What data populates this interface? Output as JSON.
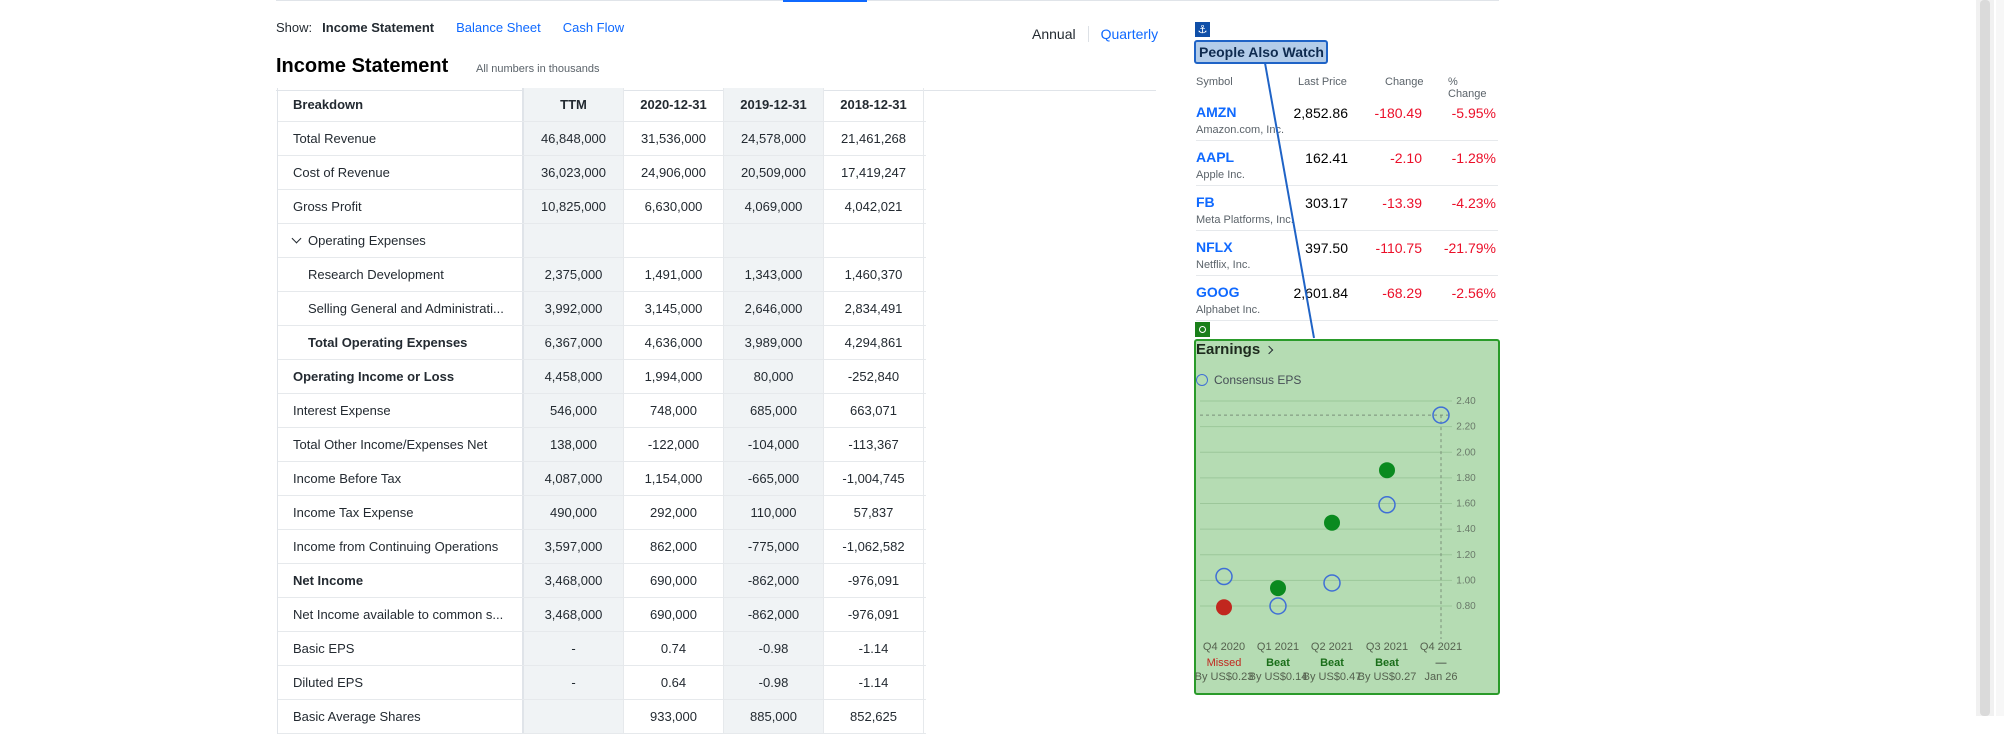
{
  "show": {
    "label": "Show:",
    "options": [
      "Income Statement",
      "Balance Sheet",
      "Cash Flow"
    ]
  },
  "period": {
    "annual": "Annual",
    "quarterly": "Quarterly"
  },
  "statement": {
    "title": "Income Statement",
    "note": "All numbers in thousands",
    "headers": [
      "Breakdown",
      "TTM",
      "2020-12-31",
      "2019-12-31",
      "2018-12-31"
    ],
    "rows": [
      {
        "label": "Total Revenue",
        "values": [
          "46,848,000",
          "31,536,000",
          "24,578,000",
          "21,461,268"
        ]
      },
      {
        "label": "Cost of Revenue",
        "values": [
          "36,023,000",
          "24,906,000",
          "20,509,000",
          "17,419,247"
        ]
      },
      {
        "label": "Gross Profit",
        "values": [
          "10,825,000",
          "6,630,000",
          "4,069,000",
          "4,042,021"
        ]
      },
      {
        "label": "Operating Expenses",
        "values": [
          "",
          "",
          "",
          ""
        ]
      },
      {
        "label": "Research Development",
        "values": [
          "2,375,000",
          "1,491,000",
          "1,343,000",
          "1,460,370"
        ]
      },
      {
        "label": "Selling General and Administrati...",
        "values": [
          "3,992,000",
          "3,145,000",
          "2,646,000",
          "2,834,491"
        ]
      },
      {
        "label": "Total Operating Expenses",
        "values": [
          "6,367,000",
          "4,636,000",
          "3,989,000",
          "4,294,861"
        ]
      },
      {
        "label": "Operating Income or Loss",
        "values": [
          "4,458,000",
          "1,994,000",
          "80,000",
          "-252,840"
        ]
      },
      {
        "label": "Interest Expense",
        "values": [
          "546,000",
          "748,000",
          "685,000",
          "663,071"
        ]
      },
      {
        "label": "Total Other Income/Expenses Net",
        "values": [
          "138,000",
          "-122,000",
          "-104,000",
          "-113,367"
        ]
      },
      {
        "label": "Income Before Tax",
        "values": [
          "4,087,000",
          "1,154,000",
          "-665,000",
          "-1,004,745"
        ]
      },
      {
        "label": "Income Tax Expense",
        "values": [
          "490,000",
          "292,000",
          "110,000",
          "57,837"
        ]
      },
      {
        "label": "Income from Continuing Operations",
        "values": [
          "3,597,000",
          "862,000",
          "-775,000",
          "-1,062,582"
        ]
      },
      {
        "label": "Net Income",
        "values": [
          "3,468,000",
          "690,000",
          "-862,000",
          "-976,091"
        ]
      },
      {
        "label": "Net Income available to common s...",
        "values": [
          "3,468,000",
          "690,000",
          "-862,000",
          "-976,091"
        ]
      },
      {
        "label": "Basic EPS",
        "values": [
          "-",
          "0.74",
          "-0.98",
          "-1.14"
        ]
      },
      {
        "label": "Diluted EPS",
        "values": [
          "-",
          "0.64",
          "-0.98",
          "-1.14"
        ]
      },
      {
        "label": "Basic Average Shares",
        "values": [
          "",
          "933,000",
          "885,000",
          "852,625"
        ]
      }
    ]
  },
  "people_also_watch": {
    "title": "People Also Watch",
    "anchor_icon": "anchor-icon",
    "headers": [
      "Symbol",
      "Last Price",
      "Change",
      "% Change"
    ],
    "items": [
      {
        "symbol": "AMZN",
        "name": "Amazon.com, Inc.",
        "price": "2,852.86",
        "change": "-180.49",
        "pct": "-5.95%"
      },
      {
        "symbol": "AAPL",
        "name": "Apple Inc.",
        "price": "162.41",
        "change": "-2.10",
        "pct": "-1.28%"
      },
      {
        "symbol": "FB",
        "name": "Meta Platforms, Inc.",
        "price": "303.17",
        "change": "-13.39",
        "pct": "-4.23%"
      },
      {
        "symbol": "NFLX",
        "name": "Netflix, Inc.",
        "price": "397.50",
        "change": "-110.75",
        "pct": "-21.79%"
      },
      {
        "symbol": "GOOG",
        "name": "Alphabet Inc.",
        "price": "2,601.84",
        "change": "-68.29",
        "pct": "-2.56%"
      }
    ]
  },
  "earnings": {
    "title": "Earnings",
    "legend": "Consensus EPS",
    "colors": {
      "beat": "#0a8a1f",
      "missed": "#c1271e",
      "consensus": "#3f6fd6"
    }
  },
  "chart_data": {
    "type": "scatter",
    "categories": [
      "Q4 2020",
      "Q1 2021",
      "Q2 2021",
      "Q3 2021",
      "Q4 2021"
    ],
    "yticks": [
      "0.80",
      "1.00",
      "1.20",
      "1.40",
      "1.60",
      "1.80",
      "2.00",
      "2.20",
      "2.40"
    ],
    "ylim": [
      0.7,
      2.45
    ],
    "consensus": [
      1.03,
      0.8,
      0.98,
      1.59,
      2.29
    ],
    "actual": [
      0.79,
      0.94,
      1.45,
      1.86,
      null
    ],
    "status": [
      "Missed",
      "Beat",
      "Beat",
      "Beat",
      "—"
    ],
    "detail": [
      "By US$0.23",
      "By US$0.14",
      "By US$0.47",
      "By US$0.27",
      "Jan 26"
    ]
  }
}
